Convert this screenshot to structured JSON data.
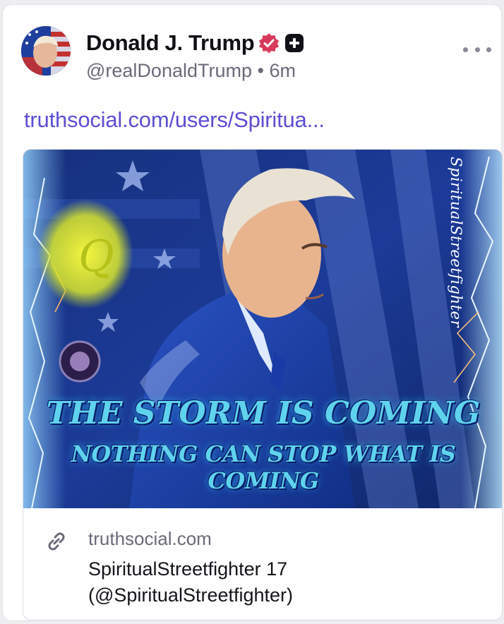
{
  "post": {
    "author_name": "Donald J. Trump",
    "handle": "@realDonaldTrump",
    "separator": "•",
    "time": "6m",
    "link_text": "truthsocial.com/users/Spiritua..."
  },
  "preview": {
    "headline_1": "THE STORM IS COMING",
    "headline_2": "NOTHING CAN STOP WHAT IS COMING",
    "watermark": "SpiritualStreetfighter",
    "overlay_letter": "Q",
    "domain": "truthsocial.com",
    "title_line_1": "SpiritualStreetfighter 17",
    "title_line_2": "(@SpiritualStreetfighter)"
  },
  "icons": {
    "verified": "verified-badge-icon",
    "plus": "plus-badge-icon",
    "more": "more-options-icon",
    "link": "link-icon"
  },
  "colors": {
    "link": "#5b4fd3",
    "verified": "#d8395b",
    "headline": "#5fd3ee"
  }
}
